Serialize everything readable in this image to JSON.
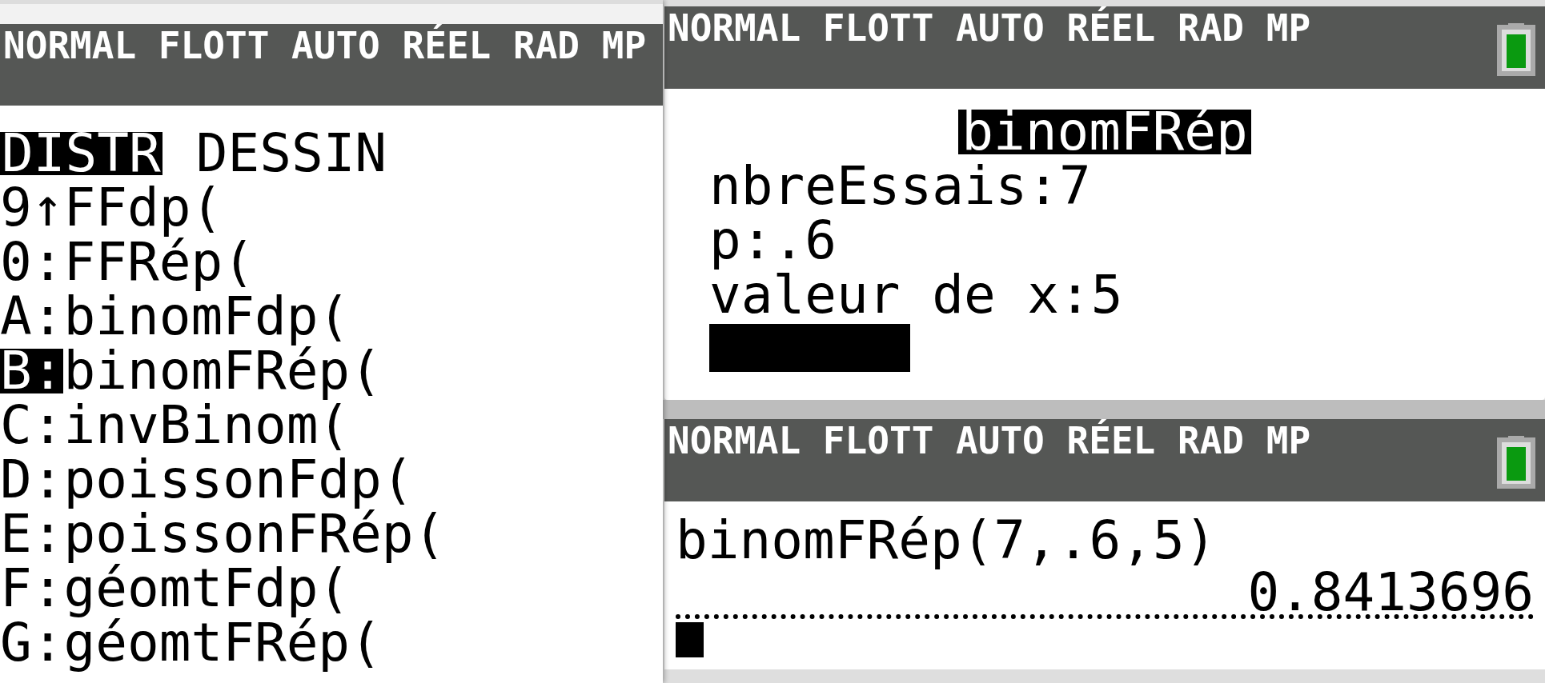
{
  "menu_screen": {
    "status_bar": "NORMAL FLOTT AUTO RÉEL RAD MP",
    "tabs": [
      {
        "label": "DISTR",
        "selected": true
      },
      {
        "label": "DESSIN",
        "selected": false
      }
    ],
    "items": [
      {
        "key": "9↑",
        "label": "FFdp(",
        "selected": false
      },
      {
        "key": "0:",
        "label": "FFRép(",
        "selected": false
      },
      {
        "key": "A:",
        "label": "binomFdp(",
        "selected": false
      },
      {
        "key": "B:",
        "label": "binomFRép(",
        "selected": true
      },
      {
        "key": "C:",
        "label": "invBinom(",
        "selected": false
      },
      {
        "key": "D:",
        "label": "poissonFdp(",
        "selected": false
      },
      {
        "key": "E:",
        "label": "poissonFRép(",
        "selected": false
      },
      {
        "key": "F:",
        "label": "géomtFdp(",
        "selected": false
      },
      {
        "key": "G:",
        "label": "géomtFRép(",
        "selected": false
      }
    ]
  },
  "wizard_screen": {
    "status_bar": "NORMAL FLOTT AUTO RÉEL RAD MP",
    "title": "binomFRép",
    "lines": [
      "nbreEssais:7",
      "p:.6",
      "valeur de x:5"
    ]
  },
  "home_screen": {
    "status_bar": "NORMAL FLOTT AUTO RÉEL RAD MP",
    "entry": "binomFRép(7,.6,5)",
    "result": "0.8413696"
  }
}
